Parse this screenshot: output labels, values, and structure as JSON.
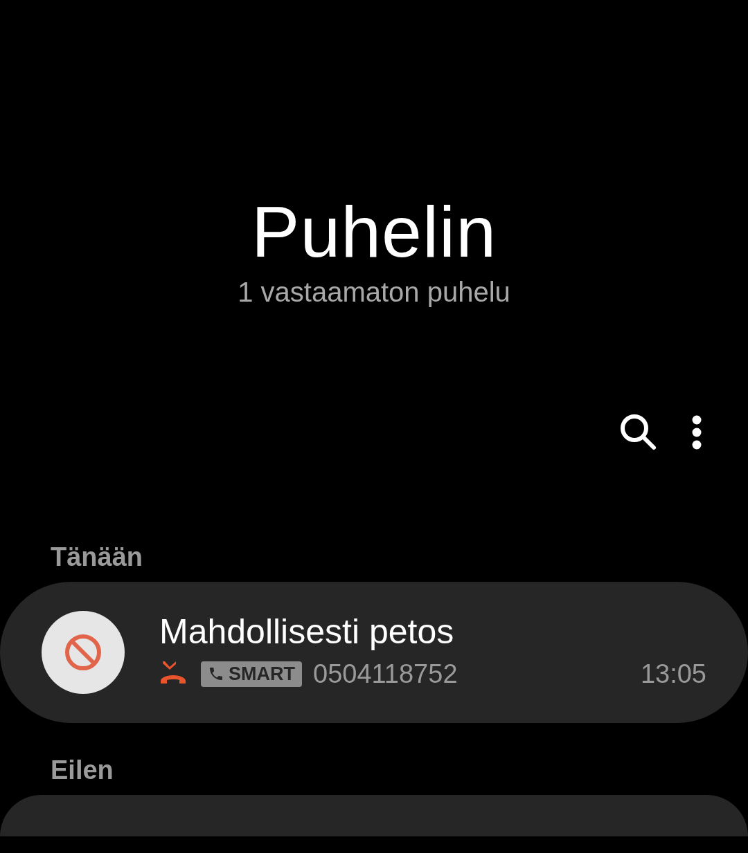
{
  "title": "Puhelin",
  "subtitle": "1 vastaamaton puhelu",
  "sections": [
    {
      "label": "Tänään",
      "calls": [
        {
          "kind": "entry",
          "name": "Mahdollisesti petos",
          "blocked": true,
          "missed": true,
          "tag": "SMART",
          "number": "0504118752",
          "time": "13:05"
        }
      ]
    },
    {
      "label": "Eilen",
      "calls": [
        {
          "kind": "cut"
        }
      ]
    }
  ]
}
